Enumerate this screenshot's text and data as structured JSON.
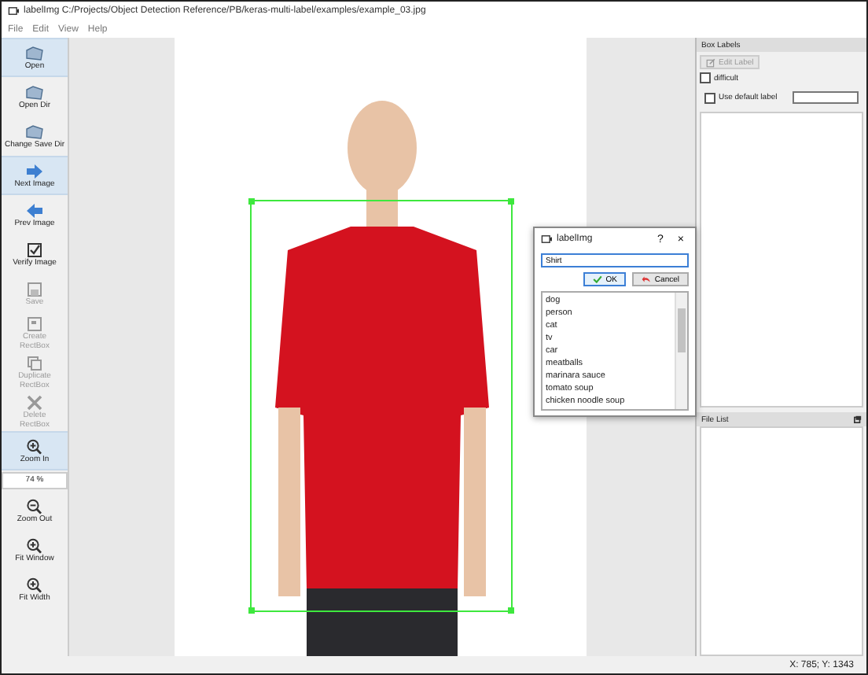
{
  "window": {
    "title": "labelImg C:/Projects/Object Detection Reference/PB/keras-multi-label/examples/example_03.jpg"
  },
  "menu": [
    "File",
    "Edit",
    "View",
    "Help"
  ],
  "toolbar": {
    "items": [
      {
        "kind": "tool",
        "label": "Open",
        "highlighted": true,
        "disabled": false
      },
      {
        "kind": "tool",
        "label": "Open Dir",
        "highlighted": false,
        "disabled": false
      },
      {
        "kind": "tool",
        "label": "Change Save Dir",
        "highlighted": false,
        "disabled": false
      },
      {
        "kind": "tool",
        "label": "Next Image",
        "highlighted": true,
        "disabled": false
      },
      {
        "kind": "tool",
        "label": "Prev Image",
        "highlighted": false,
        "disabled": false
      },
      {
        "kind": "tool",
        "label": "Verify Image",
        "highlighted": false,
        "disabled": false
      },
      {
        "kind": "tool",
        "label": "Save",
        "highlighted": false,
        "disabled": true
      },
      {
        "kind": "tool",
        "label": "Create\nRectBox",
        "highlighted": false,
        "disabled": true
      },
      {
        "kind": "tool",
        "label": "Duplicate\nRectBox",
        "highlighted": false,
        "disabled": true
      },
      {
        "kind": "tool",
        "label": "Delete\nRectBox",
        "highlighted": false,
        "disabled": true
      },
      {
        "kind": "tool",
        "label": "Zoom In",
        "highlighted": true,
        "disabled": false
      },
      {
        "kind": "zoom",
        "label": "74 %"
      },
      {
        "kind": "tool",
        "label": "Zoom Out",
        "highlighted": false,
        "disabled": false
      },
      {
        "kind": "tool",
        "label": "Fit Window",
        "highlighted": false,
        "disabled": false
      },
      {
        "kind": "tool",
        "label": "Fit Width",
        "highlighted": false,
        "disabled": false
      }
    ]
  },
  "dialog": {
    "title": "labelImg",
    "help": "?",
    "close": "×",
    "value": "Shirt",
    "ok": "OK",
    "cancel": "Cancel",
    "items": [
      "dog",
      "person",
      "cat",
      "tv",
      "car",
      "meatballs",
      "marinara sauce",
      "tomato soup",
      "chicken noodle soup"
    ]
  },
  "box_labels": {
    "title": "Box Labels",
    "edit_label": "Edit Label",
    "edit_disabled": true,
    "difficult": {
      "label": "difficult",
      "checked": false
    },
    "use_default": {
      "label": "Use default label",
      "checked": false
    }
  },
  "file_list": {
    "title": "File List"
  },
  "status_bar": "X: 785; Y: 1343"
}
